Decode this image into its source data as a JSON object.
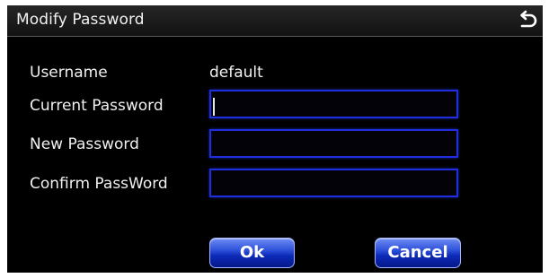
{
  "dialog": {
    "title": "Modify Password",
    "back_icon": "return-arrow-icon"
  },
  "form": {
    "username_label": "Username",
    "username_value": "default",
    "current_password_label": "Current Password",
    "current_password_value": "",
    "new_password_label": "New Password",
    "new_password_value": "",
    "confirm_password_label": "Confirm PassWord",
    "confirm_password_value": ""
  },
  "buttons": {
    "ok_label": "Ok",
    "cancel_label": "Cancel"
  },
  "colors": {
    "field_border": "#1e2ee0",
    "button_blue": "#0d2bb8",
    "background": "#000000"
  }
}
